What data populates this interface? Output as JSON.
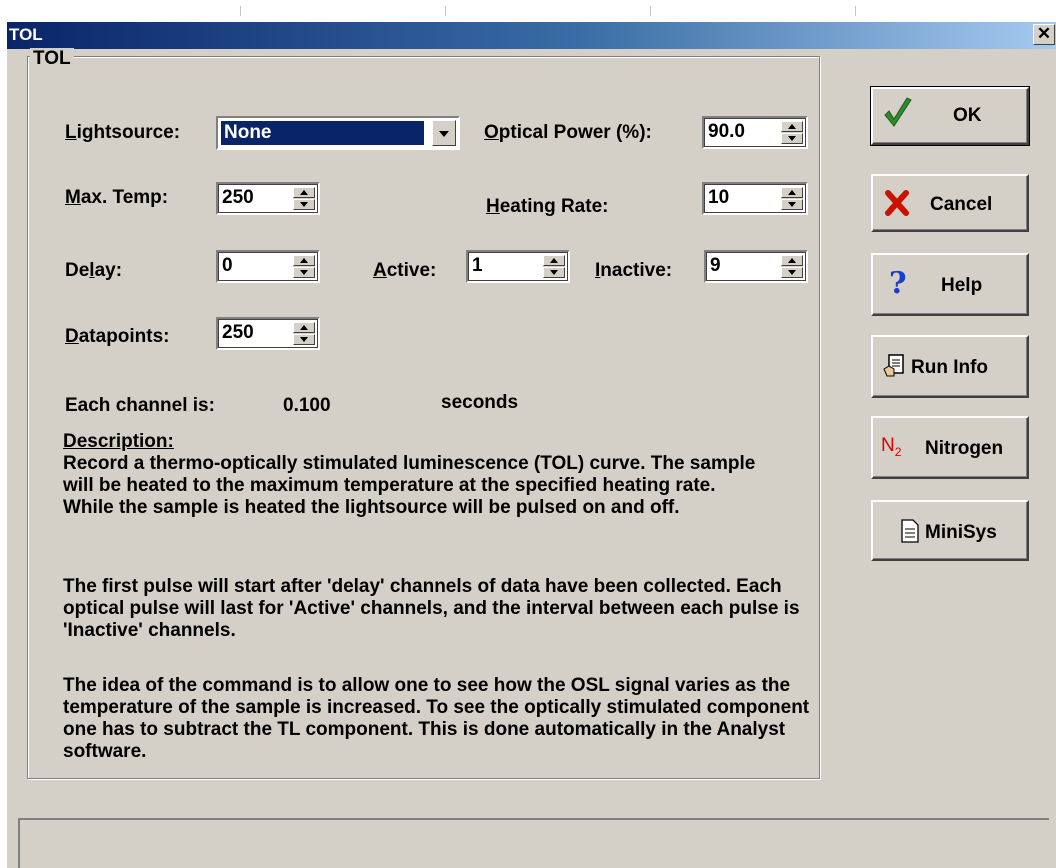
{
  "window": {
    "title": "TOL",
    "close_glyph": "✕"
  },
  "group": {
    "label": "TOL"
  },
  "lightsource": {
    "label_u": "L",
    "label_rest": "ightsource:",
    "value": "None"
  },
  "optical_power": {
    "label_u": "O",
    "label_rest": "ptical Power (%):",
    "value": "90.0"
  },
  "max_temp": {
    "label_u": "M",
    "label_rest": "ax. Temp:",
    "value": "250"
  },
  "heating_rate": {
    "label_u": "H",
    "label_rest": "eating Rate:",
    "value": "10"
  },
  "delay": {
    "label_pre": "De",
    "label_u": "l",
    "label_rest": "ay:",
    "value": "0"
  },
  "active": {
    "label_u": "A",
    "label_rest": "ctive:",
    "value": "1"
  },
  "inactive": {
    "label_u": "I",
    "label_rest": "nactive:",
    "value": "9"
  },
  "datapoints": {
    "label_u": "D",
    "label_rest": "atapoints:",
    "value": "250"
  },
  "channel": {
    "label": "Each channel is:",
    "value": "0.100",
    "unit": "seconds"
  },
  "description": {
    "heading": "Description:",
    "paragraphs": [
      "Record a thermo-optically stimulated luminescence (TOL) curve. The sample will be heated to the maximum temperature at the specified heating rate. While the sample is heated the lightsource will be pulsed on and off.",
      "The first pulse will start after 'delay' channels of data have been collected. Each optical pulse will last for 'Active' channels, and the interval between each pulse is 'Inactive' channels.",
      "The idea of the command is to allow one to see how the OSL signal varies as the temperature of the sample is increased. To see the optically stimulated component one has to subtract the TL component. This is done automatically in the Analyst software."
    ]
  },
  "buttons": {
    "ok": {
      "label": "OK",
      "icon": "checkmark-icon",
      "color": "#2e8b2e"
    },
    "cancel": {
      "label": "Cancel",
      "icon": "x-icon",
      "color": "#cc1100"
    },
    "help": {
      "label": "Help",
      "icon": "question-icon",
      "color": "#1a3fd0"
    },
    "run_info": {
      "label": "Run Info",
      "icon": "document-hand-icon"
    },
    "nitrogen": {
      "label": "Nitrogen",
      "icon": "n2-icon",
      "icon_text": "N",
      "icon_sub": "2",
      "color": "#e00000"
    },
    "minisys": {
      "label": "MiniSys",
      "icon": "page-icon"
    }
  },
  "colors": {
    "face": "#d4d0c8",
    "title_start": "#0a246a",
    "title_end": "#a6caf0",
    "selection": "#0a246a"
  }
}
